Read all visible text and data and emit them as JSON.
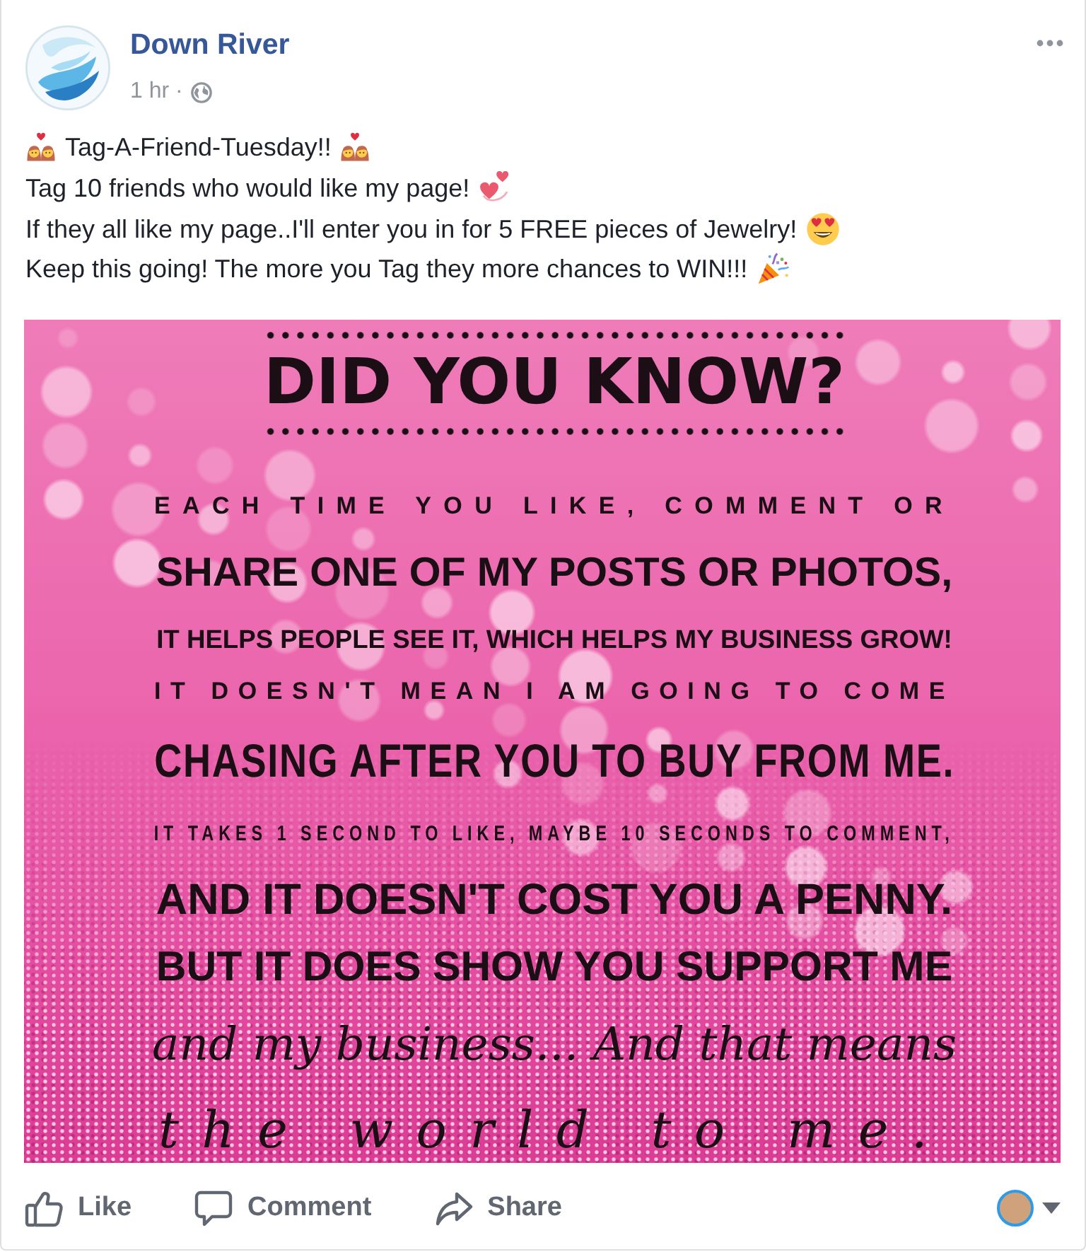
{
  "post": {
    "author": "Down River",
    "time": "1 hr ·",
    "message": [
      "Tag-A-Friend-Tuesday!!",
      "Tag 10 friends who would like my page!",
      "If they all like my page..I'll enter you in for 5 FREE pieces of Jewelry!",
      "Keep this going! The more you Tag they more chances to WIN!!!"
    ]
  },
  "image": {
    "lines": [
      {
        "kind": "title",
        "text": "DID YOU KNOW?"
      },
      {
        "kind": "spaced",
        "text": "EACH TIME YOU LIKE, COMMENT OR"
      },
      {
        "kind": "bold",
        "text": "SHARE ONE OF MY POSTS OR PHOTOS,"
      },
      {
        "kind": "small",
        "text": "IT HELPS PEOPLE SEE IT, WHICH HELPS MY BUSINESS GROW!"
      },
      {
        "kind": "spaced",
        "text": "IT DOESN'T MEAN I AM GOING TO COME"
      },
      {
        "kind": "condensed",
        "text": "CHASING AFTER YOU TO BUY FROM ME."
      },
      {
        "kind": "narrow",
        "text": "IT TAKES 1 SECOND TO LIKE, MAYBE 10 SECONDS TO COMMENT,"
      },
      {
        "kind": "bold",
        "text": "AND IT DOESN'T COST YOU A PENNY."
      },
      {
        "kind": "bold",
        "text": "BUT IT DOES SHOW YOU SUPPORT ME"
      },
      {
        "kind": "script",
        "text": "and my business... And that means"
      },
      {
        "kind": "flourish",
        "text": "the world to me."
      }
    ]
  },
  "actions": [
    {
      "kind": "like",
      "label": "Like"
    },
    {
      "kind": "comment",
      "label": "Comment"
    },
    {
      "kind": "share",
      "label": "Share"
    }
  ]
}
